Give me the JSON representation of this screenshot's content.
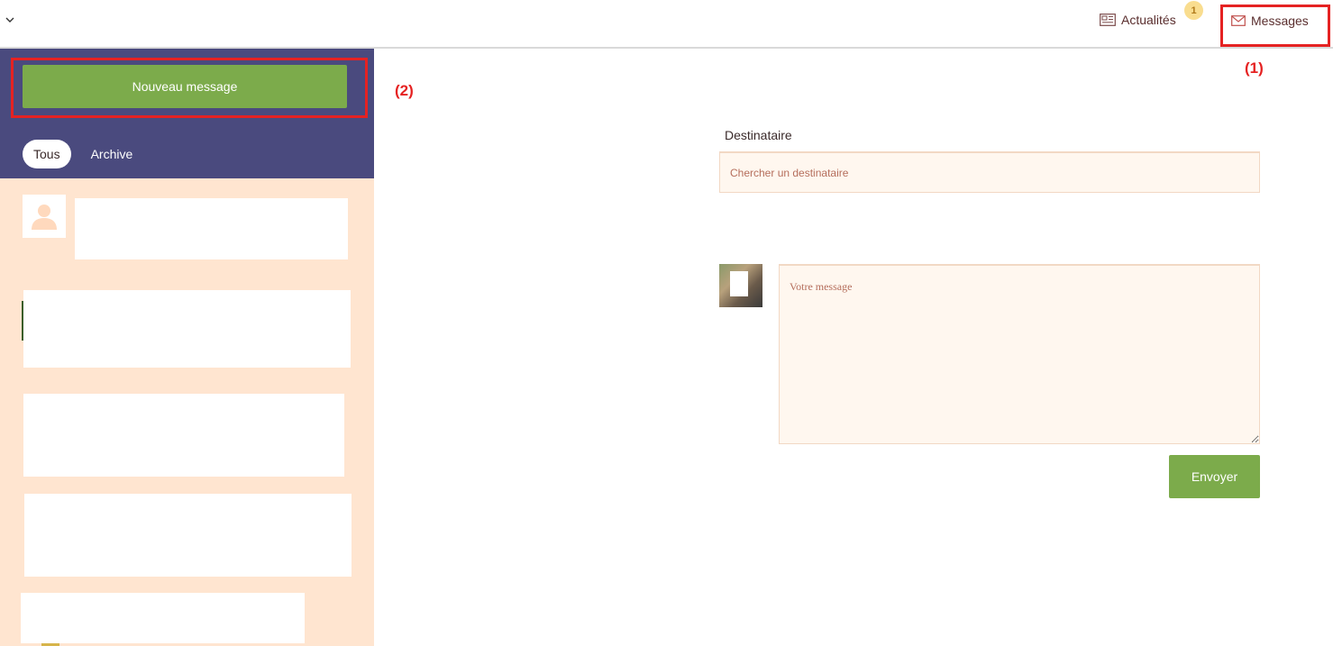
{
  "header": {
    "news_label": "Actualités",
    "news_badge": "1",
    "messages_label": "Messages"
  },
  "annotations": {
    "one": "(1)",
    "two": "(2)"
  },
  "sidebar": {
    "new_message_label": "Nouveau message",
    "tabs": [
      {
        "label": "Tous",
        "active": true
      },
      {
        "label": "Archive",
        "active": false
      }
    ]
  },
  "composer": {
    "recipient_label": "Destinataire",
    "recipient_placeholder": "Chercher un destinataire",
    "message_placeholder": "Votre message",
    "send_label": "Envoyer"
  },
  "colors": {
    "sidebar_header": "#4a4a7e",
    "sidebar_bg": "#ffe5d0",
    "button_green": "#7cab4b",
    "highlight_red": "#e52222",
    "input_bg": "#fff7ef",
    "badge_yellow": "#f9dd8f"
  },
  "icons": {
    "dropdown": "chevron-down-icon",
    "news": "newspaper-icon",
    "messages": "envelope-icon",
    "default_avatar": "user-silhouette-icon"
  }
}
